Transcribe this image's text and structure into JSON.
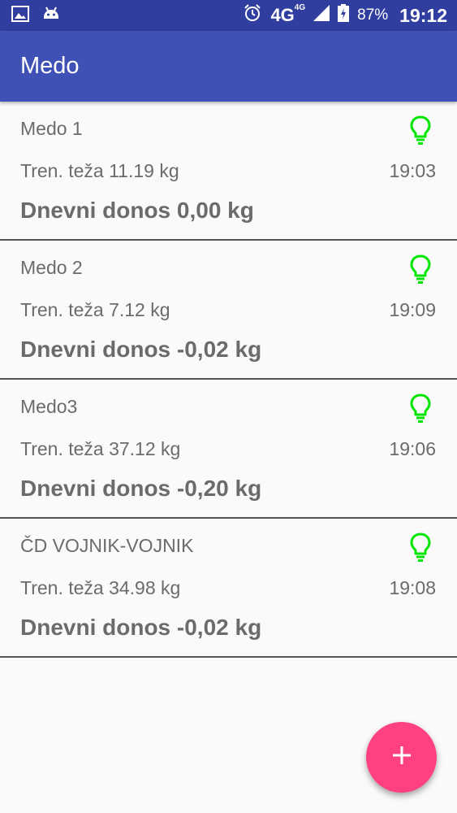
{
  "status_bar": {
    "network": "4G",
    "network_small": "4G",
    "battery": "87%",
    "clock": "19:12"
  },
  "app_bar": {
    "title": "Medo"
  },
  "devices": [
    {
      "name": "Medo 1",
      "weight": "Tren. teža 11.19 kg",
      "time": "19:03",
      "yield": "Dnevni donos 0,00 kg",
      "status_icon": "lightbulb-icon",
      "status_color": "#00e600"
    },
    {
      "name": "Medo 2",
      "weight": "Tren. teža 7.12 kg",
      "time": "19:09",
      "yield": "Dnevni donos -0,02 kg",
      "status_icon": "lightbulb-icon",
      "status_color": "#00e600"
    },
    {
      "name": "Medo3",
      "weight": "Tren. teža 37.12 kg",
      "time": "19:06",
      "yield": "Dnevni donos -0,20 kg",
      "status_icon": "lightbulb-icon",
      "status_color": "#00e600"
    },
    {
      "name": "ČD VOJNIK-VOJNIK",
      "weight": "Tren. teža 34.98 kg",
      "time": "19:08",
      "yield": "Dnevni donos -0,02 kg",
      "status_icon": "lightbulb-icon",
      "status_color": "#00e600"
    }
  ],
  "fab": {
    "icon": "plus-icon",
    "color": "#ff4081"
  },
  "colors": {
    "status_bar": "#303f9f",
    "app_bar": "#3f51b5",
    "accent": "#ff4081"
  }
}
